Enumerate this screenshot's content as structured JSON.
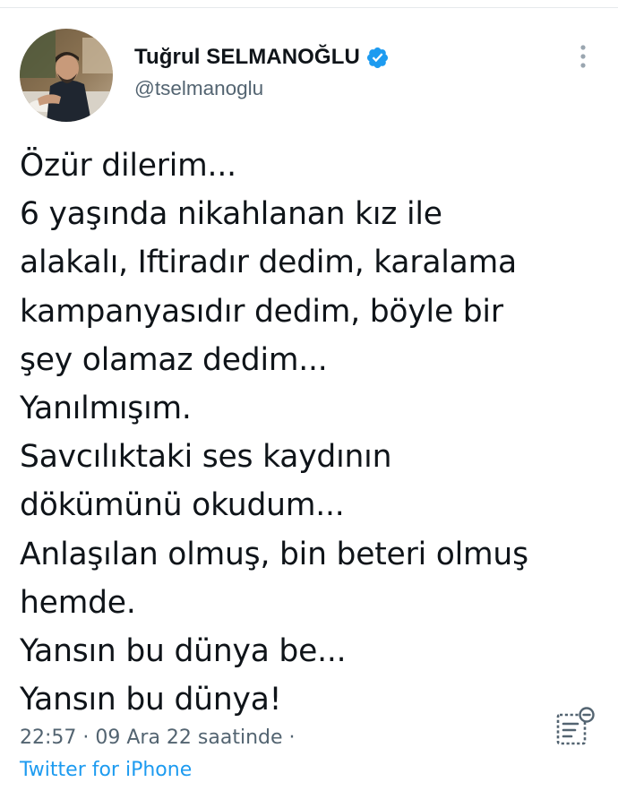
{
  "author": {
    "display_name": "Tuğrul SELMANOĞLU",
    "handle": "@tselmanoglu",
    "verified": true,
    "avatar_icon": "profile-photo"
  },
  "tweet": {
    "lines": [
      "Özür dilerim...",
      "6 yaşında nikahlanan kız ile",
      "alakalı, Iftiradır dedim, karalama",
      "kampanyasıdır dedim, böyle bir",
      "şey olamaz dedim...",
      "Yanılmışım.",
      "Savcılıktaki ses kaydının",
      "dökümünü okudum...",
      "Anlaşılan olmuş, bin beteri olmuş",
      "hemde.",
      "Yansın bu dünya be...",
      "Yansın bu dünya!"
    ]
  },
  "meta": {
    "timestamp": "22:57 · 09 Ara 22 saatinde ·",
    "source": "Twitter for iPhone"
  },
  "icons": {
    "more": "more-vertical-icon",
    "verified": "verified-badge-icon",
    "analytics": "view-analytics-icon"
  },
  "colors": {
    "text_primary": "#0f1419",
    "text_secondary": "#536471",
    "accent": "#1d9bf0"
  }
}
